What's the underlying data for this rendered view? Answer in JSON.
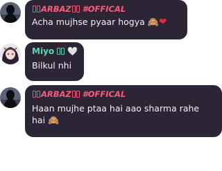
{
  "messages": [
    {
      "sender": {
        "prefix_glyphs": "▯▯",
        "name": "ARBAZ",
        "suffix_glyphs": "▯▯",
        "tag": "#OFFICAL",
        "color": "#ff5a7a"
      },
      "text": "Acha mujhse pyaar hogya",
      "emojis": [
        "🙈",
        "❤"
      ]
    },
    {
      "sender": {
        "name": "Miyo",
        "suffix_glyphs": "▯▯",
        "heart": "🤍",
        "color": "#5fd9b0"
      },
      "text": "Bilkul nhi"
    },
    {
      "sender": {
        "prefix_glyphs": "▯▯",
        "name": "ARBAZ",
        "suffix_glyphs": "▯▯",
        "tag": "#OFFICAL",
        "color": "#ff5a7a"
      },
      "text_line1": "Haan mujhe ptaa hai aao sharma rahe",
      "text_line2": "hai",
      "emojis": [
        "🙈"
      ]
    }
  ],
  "colors": {
    "bubble": "#2b2535",
    "message_text": "#f4f1f7",
    "background": "#ffffff"
  },
  "icons": {
    "avatar_1": "dark-hooded-figure-avatar-icon",
    "avatar_2": "anime-girl-avatar-icon",
    "avatar_3": "dark-hooded-figure-avatar-icon"
  }
}
